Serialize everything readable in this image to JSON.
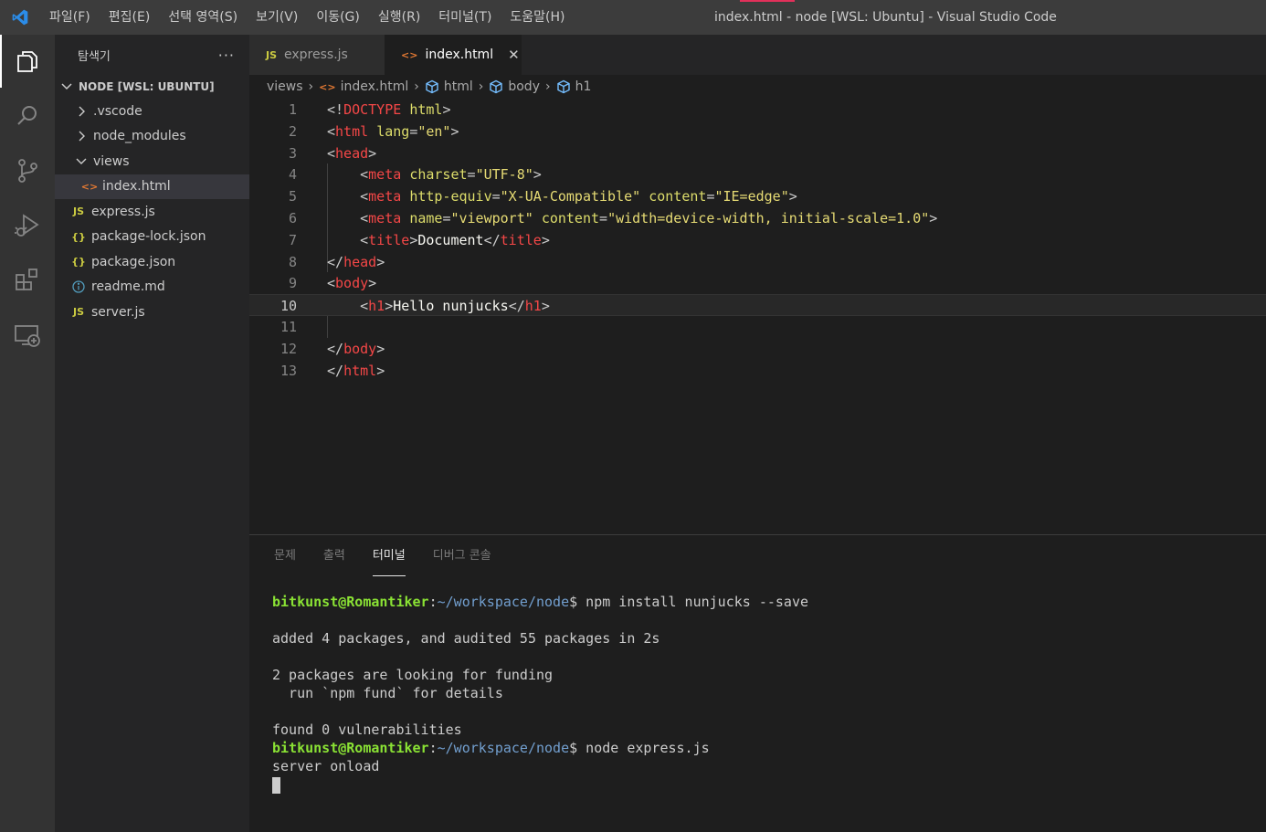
{
  "titlebar": {
    "menus": [
      "파일(F)",
      "편집(E)",
      "선택 영역(S)",
      "보기(V)",
      "이동(G)",
      "실행(R)",
      "터미널(T)",
      "도움말(H)"
    ],
    "window_title": "index.html - node [WSL: Ubuntu] - Visual Studio Code"
  },
  "activity": [
    "explorer-icon",
    "search-icon",
    "source-control-icon",
    "run-debug-icon",
    "extensions-icon",
    "remote-explorer-icon"
  ],
  "sidebar": {
    "title": "탐색기",
    "more": "···",
    "section": "NODE [WSL: UBUNTU]",
    "items": [
      {
        "label": ".vscode",
        "type": "folder",
        "open": false
      },
      {
        "label": "node_modules",
        "type": "folder",
        "open": false
      },
      {
        "label": "views",
        "type": "folder",
        "open": true
      },
      {
        "label": "index.html",
        "type": "html"
      },
      {
        "label": "express.js",
        "type": "js"
      },
      {
        "label": "package-lock.json",
        "type": "json"
      },
      {
        "label": "package.json",
        "type": "json"
      },
      {
        "label": "readme.md",
        "type": "info"
      },
      {
        "label": "server.js",
        "type": "js"
      }
    ],
    "file_icon_js": "JS",
    "file_icon_json": "{}"
  },
  "tabs": [
    {
      "label": "express.js",
      "icon": "JS"
    },
    {
      "label": "index.html",
      "icon": "<>"
    }
  ],
  "breadcrumb": [
    "views",
    "index.html",
    "html",
    "body",
    "h1"
  ],
  "editor": {
    "current_line": 10,
    "line_numbers": [
      "1",
      "2",
      "3",
      "4",
      "5",
      "6",
      "7",
      "8",
      "9",
      "10",
      "11",
      "12",
      "13"
    ],
    "lines": [
      [
        [
          "p",
          "<!"
        ],
        [
          "t",
          "DOCTYPE"
        ],
        [
          "p",
          " "
        ],
        [
          "a",
          "html"
        ],
        [
          "p",
          ">"
        ]
      ],
      [
        [
          "p",
          "<"
        ],
        [
          "t",
          "html"
        ],
        [
          "p",
          " "
        ],
        [
          "a",
          "lang"
        ],
        [
          "p",
          "="
        ],
        [
          "s",
          "\"en\""
        ],
        [
          "p",
          ">"
        ]
      ],
      [
        [
          "p",
          "<"
        ],
        [
          "t",
          "head"
        ],
        [
          "p",
          ">"
        ]
      ],
      [
        [
          "p",
          "    <"
        ],
        [
          "t",
          "meta"
        ],
        [
          "p",
          " "
        ],
        [
          "a",
          "charset"
        ],
        [
          "p",
          "="
        ],
        [
          "s",
          "\"UTF-8\""
        ],
        [
          "p",
          ">"
        ]
      ],
      [
        [
          "p",
          "    <"
        ],
        [
          "t",
          "meta"
        ],
        [
          "p",
          " "
        ],
        [
          "a",
          "http-equiv"
        ],
        [
          "p",
          "="
        ],
        [
          "s",
          "\"X-UA-Compatible\""
        ],
        [
          "p",
          " "
        ],
        [
          "a",
          "content"
        ],
        [
          "p",
          "="
        ],
        [
          "s",
          "\"IE=edge\""
        ],
        [
          "p",
          ">"
        ]
      ],
      [
        [
          "p",
          "    <"
        ],
        [
          "t",
          "meta"
        ],
        [
          "p",
          " "
        ],
        [
          "a",
          "name"
        ],
        [
          "p",
          "="
        ],
        [
          "s",
          "\"viewport\""
        ],
        [
          "p",
          " "
        ],
        [
          "a",
          "content"
        ],
        [
          "p",
          "="
        ],
        [
          "s",
          "\"width=device-width, initial-scale=1.0\""
        ],
        [
          "p",
          ">"
        ]
      ],
      [
        [
          "p",
          "    <"
        ],
        [
          "t",
          "title"
        ],
        [
          "p",
          ">"
        ],
        [
          "x",
          "Document"
        ],
        [
          "p",
          "</"
        ],
        [
          "t",
          "title"
        ],
        [
          "p",
          ">"
        ]
      ],
      [
        [
          "p",
          "</"
        ],
        [
          "t",
          "head"
        ],
        [
          "p",
          ">"
        ]
      ],
      [
        [
          "p",
          "<"
        ],
        [
          "t",
          "body"
        ],
        [
          "p",
          ">"
        ]
      ],
      [
        [
          "p",
          "    <"
        ],
        [
          "t",
          "h1"
        ],
        [
          "p",
          ">"
        ],
        [
          "x",
          "Hello nunjucks"
        ],
        [
          "p",
          "</"
        ],
        [
          "t",
          "h1"
        ],
        [
          "p",
          ">"
        ]
      ],
      [],
      [
        [
          "p",
          "</"
        ],
        [
          "t",
          "body"
        ],
        [
          "p",
          ">"
        ]
      ],
      [
        [
          "p",
          "</"
        ],
        [
          "t",
          "html"
        ],
        [
          "p",
          ">"
        ]
      ]
    ]
  },
  "panel": {
    "tabs": [
      "문제",
      "출력",
      "터미널",
      "디버그 콘솔"
    ],
    "active_tab": "터미널",
    "terminal": [
      {
        "user": "bitkunst@Romantiker",
        "path": "~/workspace/node",
        "cmd": "$ npm install nunjucks --save"
      },
      {
        "text": ""
      },
      {
        "text": "added 4 packages, and audited 55 packages in 2s"
      },
      {
        "text": ""
      },
      {
        "text": "2 packages are looking for funding"
      },
      {
        "text": "  run `npm fund` for details"
      },
      {
        "text": ""
      },
      {
        "text": "found 0 vulnerabilities"
      },
      {
        "user": "bitkunst@Romantiker",
        "path": "~/workspace/node",
        "cmd": "$ node express.js"
      },
      {
        "text": "server onload"
      }
    ]
  },
  "colors": {
    "accent": "#e2305a",
    "vscode_blue": "#2b8ce8",
    "tag": "#f44747",
    "attr": "#dcdc6a",
    "string": "#e6db74",
    "terminal_user": "#8ae234",
    "terminal_path": "#729fcf"
  }
}
